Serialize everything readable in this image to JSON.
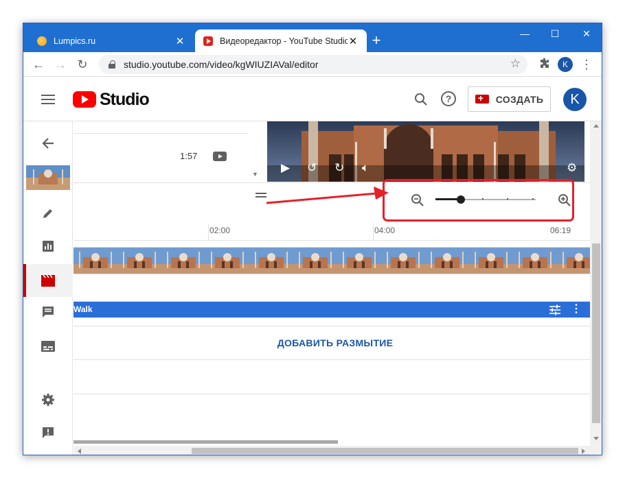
{
  "browser": {
    "tabs": [
      {
        "title": "Lumpics.ru",
        "active": false
      },
      {
        "title": "Видеоредактор - YouTube Studio",
        "active": true
      }
    ],
    "new_tab_icon": "plus-icon",
    "url": "studio.youtube.com/video/kgWIUZIAVal/editor",
    "profile_initial": "K",
    "accent_color": "#1f6fd1"
  },
  "header": {
    "logo_text": "Studio",
    "create_label": "СОЗДАТЬ",
    "avatar_initial": "K",
    "brand_color": "#ff0000"
  },
  "sidebar": {
    "items": [
      {
        "name": "back",
        "icon": "arrow-left-icon"
      },
      {
        "name": "video-thumbnail",
        "icon": "thumbnail"
      },
      {
        "name": "details",
        "icon": "pencil-icon"
      },
      {
        "name": "analytics",
        "icon": "bar-chart-icon"
      },
      {
        "name": "editor",
        "icon": "clapperboard-icon",
        "active": true
      },
      {
        "name": "comments",
        "icon": "comment-icon"
      },
      {
        "name": "subtitles",
        "icon": "subtitles-icon"
      },
      {
        "name": "settings",
        "icon": "gear-icon"
      },
      {
        "name": "feedback",
        "icon": "feedback-icon"
      }
    ]
  },
  "editor": {
    "video_duration": "1:57",
    "zoom": {
      "level_fraction": 0.25
    },
    "ruler_ticks": [
      "02:00",
      "04:00",
      "06:19"
    ],
    "audio_track_label": "Walk",
    "blur_button_label": "ДОБАВИТЬ РАЗМЫТИЕ"
  }
}
